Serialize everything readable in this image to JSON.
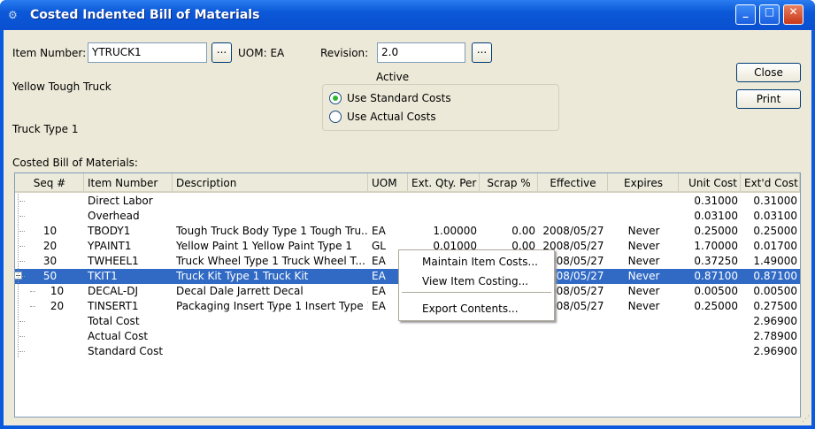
{
  "window": {
    "title": "Costed Indented Bill of Materials",
    "minimize": "_",
    "maximize": "□",
    "close": "✕"
  },
  "form": {
    "item_number_label": "Item Number:",
    "item_number": "YTRUCK1",
    "lookup": "...",
    "uom": "UOM: EA",
    "revision_label": "Revision:",
    "revision": "2.0",
    "description1": "Yellow Tough Truck",
    "description2": "Truck Type 1",
    "active_label": "Active",
    "use_standard": "Use Standard Costs",
    "use_actual": "Use Actual Costs",
    "cost_mode": "standard"
  },
  "buttons": {
    "close": "Close",
    "print": "Print"
  },
  "list": {
    "label": "Costed Bill of Materials:",
    "columns": [
      "Seq #",
      "Item Number",
      "Description",
      "UOM",
      "Ext. Qty. Per",
      "Scrap %",
      "Effective",
      "Expires",
      "Unit Cost",
      "Ext'd Cost"
    ],
    "rows": [
      [
        "",
        "Direct Labor",
        "",
        "",
        "",
        "",
        "",
        "",
        "0.31000",
        "0.31000"
      ],
      [
        "",
        "Overhead",
        "",
        "",
        "",
        "",
        "",
        "",
        "0.03100",
        "0.03100"
      ],
      [
        "10",
        "TBODY1",
        "Tough Truck Body Type 1 Tough Tru...",
        "EA",
        "1.00000",
        "0.00",
        "2008/05/27",
        "Never",
        "0.25000",
        "0.25000"
      ],
      [
        "20",
        "YPAINT1",
        "Yellow Paint 1  Yellow Paint Type 1",
        "GL",
        "0.01000",
        "0.00",
        "2008/05/27",
        "Never",
        "1.70000",
        "0.01700"
      ],
      [
        "30",
        "TWHEEL1",
        "Truck Wheel Type 1 Truck Wheel T...",
        "EA",
        "",
        "",
        "2008/05/27",
        "Never",
        "0.37250",
        "1.49000"
      ],
      [
        "50",
        "TKIT1",
        "Truck Kit Type 1 Truck Kit",
        "EA",
        "",
        "",
        "2008/05/27",
        "Never",
        "0.87100",
        "0.87100"
      ],
      [
        "10",
        "DECAL-DJ",
        "Decal Dale Jarrett Decal",
        "EA",
        "",
        "",
        "2008/05/27",
        "Never",
        "0.00500",
        "0.00500"
      ],
      [
        "20",
        "TINSERT1",
        "Packaging Insert Type 1 Insert Type 1",
        "EA",
        "",
        "",
        "2008/05/27",
        "Never",
        "0.25000",
        "0.27500"
      ],
      [
        "",
        "Total Cost",
        "",
        "",
        "",
        "",
        "",
        "",
        "",
        "2.96900"
      ],
      [
        "",
        "Actual Cost",
        "",
        "",
        "",
        "",
        "",
        "",
        "",
        "2.78900"
      ],
      [
        "",
        "Standard Cost",
        "",
        "",
        "",
        "",
        "",
        "",
        "",
        "2.96900"
      ]
    ],
    "selected_row": 5,
    "child_rows": [
      6,
      7
    ]
  },
  "context_menu": {
    "items": [
      "Maintain Item Costs...",
      "View Item Costing...",
      "Export Contents..."
    ]
  }
}
